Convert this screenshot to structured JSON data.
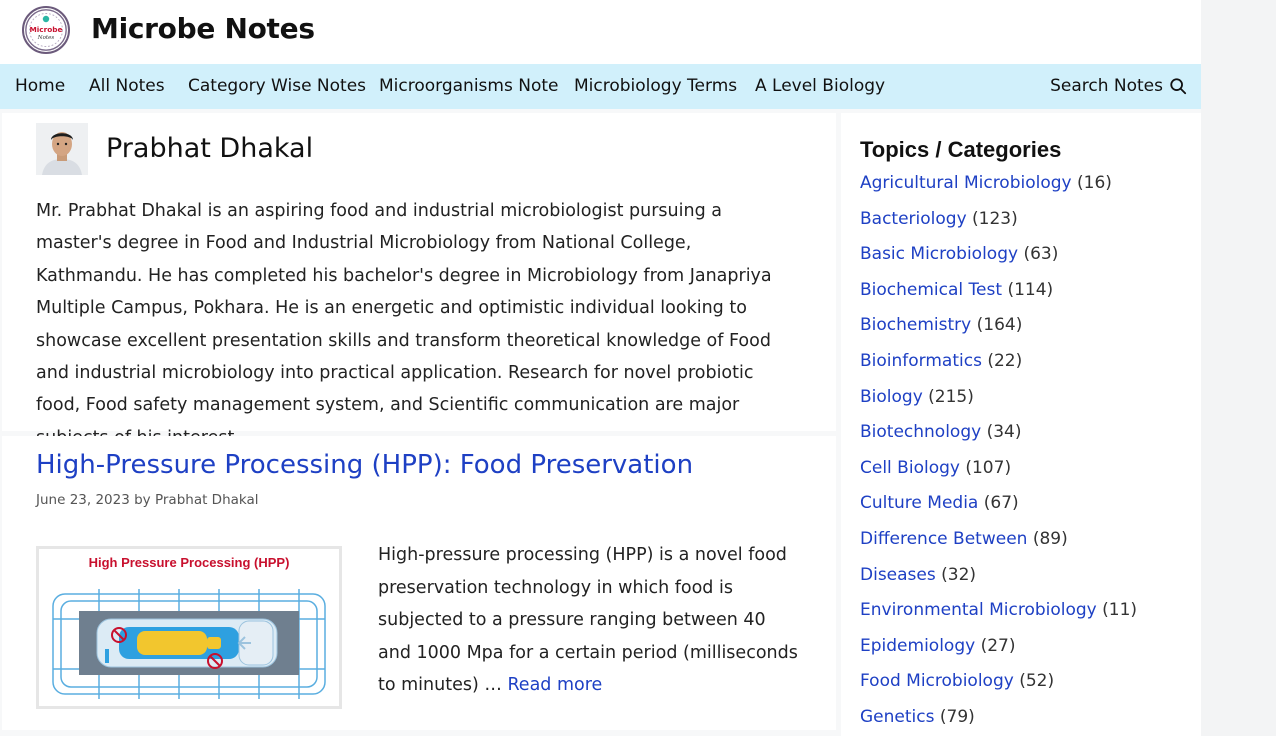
{
  "site": {
    "title": "Microbe Notes",
    "logo_text_top": "Microbe",
    "logo_text_bottom": "Notes"
  },
  "nav": {
    "items": [
      "Home",
      "All Notes",
      "Category Wise Notes",
      "Microorganisms Note",
      "Microbiology Terms",
      "A Level Biology"
    ],
    "search_label": "Search Notes"
  },
  "author": {
    "name": "Prabhat Dhakal",
    "bio": "Mr. Prabhat Dhakal is an aspiring food and industrial microbiologist pursuing a master's degree in Food and Industrial Microbiology from National College, Kathmandu. He has completed his bachelor's degree in Microbiology from Janapriya Multiple Campus, Pokhara. He is an energetic and optimistic individual looking to showcase excellent presentation skills and transform theoretical knowledge of Food and industrial microbiology into practical application. Research for novel probiotic food, Food safety management system, and Scientific communication are major subjects of his interest."
  },
  "post": {
    "title": "High-Pressure Processing (HPP): Food Preservation",
    "date": "June 23, 2023",
    "by": "by",
    "author": "Prabhat Dhakal",
    "thumb_caption": "High Pressure Processing (HPP)",
    "excerpt": "High-pressure processing (HPP) is a novel food preservation technology in which food is subjected to a pressure ranging between 40 and 1000 Mpa for a certain period (milliseconds to minutes) …",
    "read_more": "Read more"
  },
  "sidebar": {
    "title": "Topics / Categories",
    "categories": [
      {
        "name": "Agricultural Microbiology",
        "count": "(16)"
      },
      {
        "name": "Bacteriology",
        "count": "(123)"
      },
      {
        "name": "Basic Microbiology",
        "count": "(63)"
      },
      {
        "name": "Biochemical Test",
        "count": "(114)"
      },
      {
        "name": "Biochemistry",
        "count": "(164)"
      },
      {
        "name": "Bioinformatics",
        "count": "(22)"
      },
      {
        "name": "Biology",
        "count": "(215)"
      },
      {
        "name": "Biotechnology",
        "count": "(34)"
      },
      {
        "name": "Cell Biology",
        "count": "(107)"
      },
      {
        "name": "Culture Media",
        "count": "(67)"
      },
      {
        "name": "Difference Between",
        "count": "(89)"
      },
      {
        "name": "Diseases",
        "count": "(32)"
      },
      {
        "name": "Environmental Microbiology",
        "count": "(11)"
      },
      {
        "name": "Epidemiology",
        "count": "(27)"
      },
      {
        "name": "Food Microbiology",
        "count": "(52)"
      },
      {
        "name": "Genetics",
        "count": "(79)"
      }
    ]
  },
  "colors": {
    "nav_bg": "#d1f0fb",
    "link": "#1e40c4",
    "thumb_title": "#c8102e"
  }
}
